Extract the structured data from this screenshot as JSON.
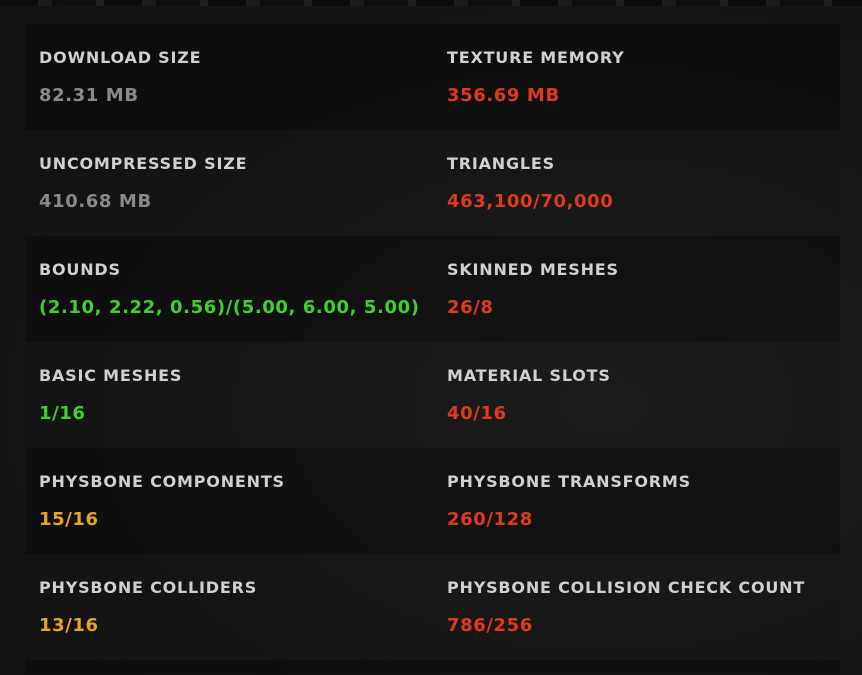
{
  "colors": {
    "neutral": "#8a8a8a",
    "good": "#3fd22e",
    "warn": "#e6a429",
    "bad": "#e03a1c",
    "label": "#d0d0d0"
  },
  "stats": [
    {
      "left": {
        "label": "DOWNLOAD SIZE",
        "value": "82.31 MB",
        "status": "neutral"
      },
      "right": {
        "label": "TEXTURE MEMORY",
        "value": "356.69 MB",
        "status": "bad"
      }
    },
    {
      "left": {
        "label": "UNCOMPRESSED SIZE",
        "value": "410.68 MB",
        "status": "neutral"
      },
      "right": {
        "label": "TRIANGLES",
        "value": "463,100/70,000",
        "status": "bad"
      }
    },
    {
      "left": {
        "label": "BOUNDS",
        "value": "(2.10, 2.22, 0.56)/(5.00, 6.00, 5.00)",
        "status": "good"
      },
      "right": {
        "label": "SKINNED MESHES",
        "value": "26/8",
        "status": "bad"
      }
    },
    {
      "left": {
        "label": "BASIC MESHES",
        "value": "1/16",
        "status": "good"
      },
      "right": {
        "label": "MATERIAL SLOTS",
        "value": "40/16",
        "status": "bad"
      }
    },
    {
      "left": {
        "label": "PHYSBONE COMPONENTS",
        "value": "15/16",
        "status": "warn"
      },
      "right": {
        "label": "PHYSBONE TRANSFORMS",
        "value": "260/128",
        "status": "bad"
      }
    },
    {
      "left": {
        "label": "PHYSBONE COLLIDERS",
        "value": "13/16",
        "status": "warn"
      },
      "right": {
        "label": "PHYSBONE COLLISION CHECK COUNT",
        "value": "786/256",
        "status": "bad"
      }
    }
  ]
}
